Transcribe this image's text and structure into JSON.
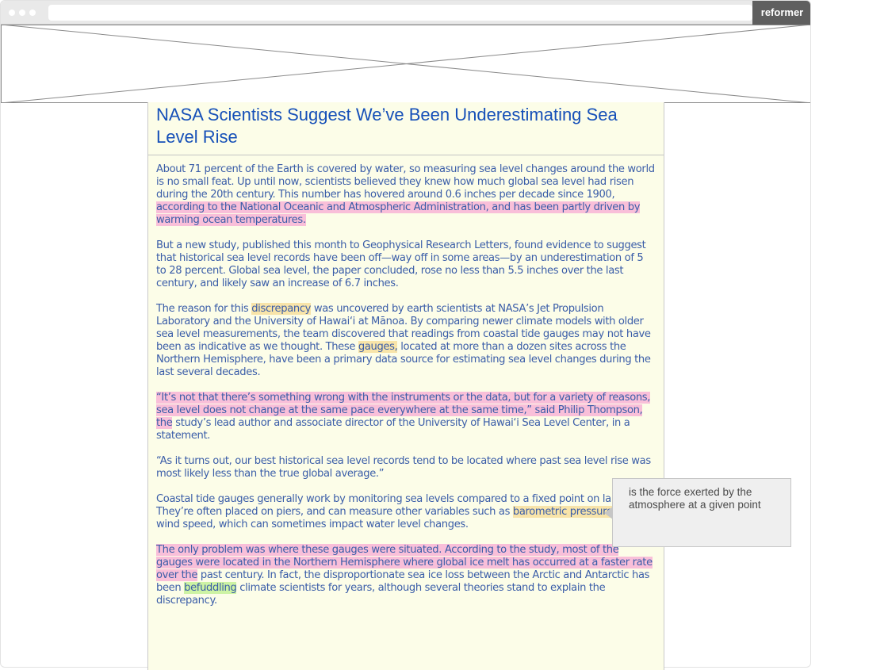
{
  "browser": {
    "brand": "reformer"
  },
  "article": {
    "title": "NASA Scientists Suggest We’ve Been Underestimating Sea Level Rise",
    "p1_a": "About 71 percent of the Earth is covered by water, so measuring sea level changes around the world is no small feat. Up until now, scientists believed they knew how much global sea level had risen during the 20th century. This number has hovered around 0.6 inches per decade since 1900, ",
    "p1_hl": "according to the National Oceanic and Atmospheric Administration, and has been partly driven by warming ocean temperatures.",
    "p2": "But a new study, published this month to Geophysical Research Letters, found evidence to suggest that historical sea level records have been off—way off in some areas—by an underestimation of 5 to 28 percent. Global sea level, the paper concluded, rose no less than 5.5 inches over the last century, and likely saw an increase of 6.7 inches.",
    "p3_a": "The reason for this ",
    "p3_hl1": "discrepancy",
    "p3_b": " was uncovered by earth scientists at NASA’s Jet Propulsion Laboratory and the University of Hawai‘i at Mānoa. By comparing newer climate models with older sea level measurements, the team discovered that readings from coastal tide gauges may not have been as indicative as we thought. These ",
    "p3_hl2": "gauges,",
    "p3_c": " located at more than a dozen sites across the Northern Hemisphere, have been a primary data source for estimating sea level changes during the last several decades.",
    "p4_hl": "“It’s not that there’s something wrong with the instruments or the data, but for a variety of reasons, sea level does not change at the same pace everywhere at the same time,” said Philip Thompson, the",
    "p4_b": " study’s lead author and associate director of the University of Hawai‘i Sea Level Center, in a statement.",
    "p5": "“As it turns out, our best historical sea level records tend to be located where past sea level rise was most likely less than the true global average.”",
    "p6_a": "Coastal tide gauges generally work by monitoring sea levels compared to a fixed point on land. They’re often placed on piers, and can measure other variables such as ",
    "p6_hl": "barometric pressure",
    "p6_b": " and wind speed, which can sometimes impact water level changes.",
    "p7_hl": "The only problem was where these gauges were situated. According to the study, most of the gauges were located in the Northern Hemisphere where global ice melt has occurred at a faster rate over the",
    "p7_b": " past century. In fact, the disproportionate sea ice loss between the Arctic and Antarctic has been ",
    "p7_hl2": "befuddling",
    "p7_c": " climate scientists for years, although several theories stand to explain the discrepancy."
  },
  "tooltip": {
    "text": "is the force exerted by the atmosphere at a given point"
  },
  "colors": {
    "headline": "#1650b8",
    "body": "#3a5da8",
    "highlight_pink": "#f9bfd9",
    "highlight_yellow": "#f8e4a9",
    "highlight_green": "#cdf3a4",
    "brand_bg": "#5f5f5f"
  }
}
